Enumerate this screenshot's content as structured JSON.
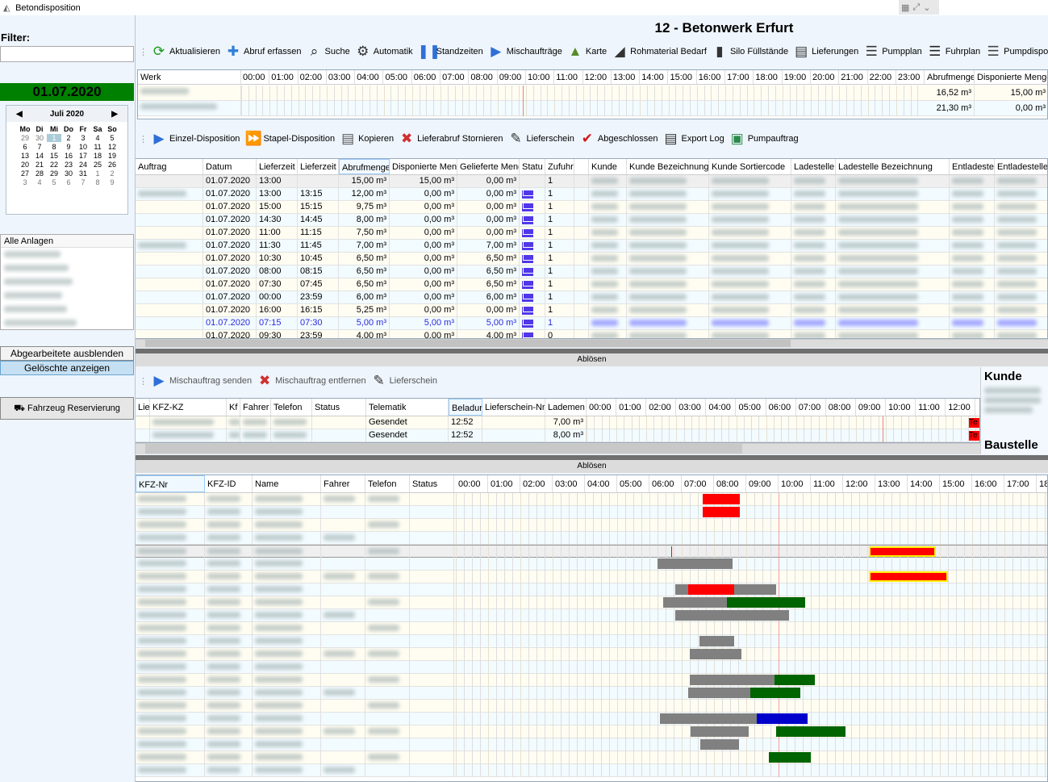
{
  "window": {
    "title": "Betondisposition"
  },
  "header": {
    "plant_title": "12 - Betonwerk Erfurt"
  },
  "left": {
    "filter_label": "Filter:",
    "filter_value": "",
    "date": "01.07.2020",
    "calendar": {
      "month": "Juli 2020",
      "days": [
        "Mo",
        "Di",
        "Mi",
        "Do",
        "Fr",
        "Sa",
        "So"
      ],
      "weeks": [
        [
          "29",
          "30",
          "1",
          "2",
          "3",
          "4",
          "5"
        ],
        [
          "6",
          "7",
          "8",
          "9",
          "10",
          "11",
          "12"
        ],
        [
          "13",
          "14",
          "15",
          "16",
          "17",
          "18",
          "19"
        ],
        [
          "20",
          "21",
          "22",
          "23",
          "24",
          "25",
          "26"
        ],
        [
          "27",
          "28",
          "29",
          "30",
          "31",
          "1",
          "2"
        ],
        [
          "3",
          "4",
          "5",
          "6",
          "7",
          "8",
          "9"
        ]
      ],
      "selected": "1"
    },
    "anlagen_header": "Alle Anlagen",
    "btn_hide": "Abgearbeitete ausblenden",
    "btn_deleted": "Gelöschte anzeigen",
    "btn_vehicle": "Fahrzeug Reservierung"
  },
  "toolbar1": [
    {
      "label": "Aktualisieren",
      "icon": "refresh-icon"
    },
    {
      "label": "Abruf erfassen",
      "icon": "plus-icon"
    },
    {
      "label": "Suche",
      "icon": "search-icon"
    },
    {
      "label": "Automatik",
      "icon": "automatic-icon"
    },
    {
      "label": "Standzeiten",
      "icon": "pause-icon"
    },
    {
      "label": "Mischaufträge",
      "icon": "play-icon"
    },
    {
      "label": "Karte",
      "icon": "map-icon"
    },
    {
      "label": "Rohmaterial Bedarf",
      "icon": "material-icon"
    },
    {
      "label": "Silo Füllstände",
      "icon": "silo-icon"
    },
    {
      "label": "Lieferungen",
      "icon": "clipboard-icon"
    },
    {
      "label": "Pumpplan",
      "icon": "pump-plan-icon"
    },
    {
      "label": "Fuhrplan",
      "icon": "truck-plan-icon"
    },
    {
      "label": "Pumpdispo",
      "icon": "pump-dispo-icon"
    },
    {
      "label": "",
      "icon": "pump-order-icon"
    }
  ],
  "werk": {
    "headers": {
      "werk": "Werk",
      "abruf": "Abrufmenge",
      "dispo": "Disponierte Menge"
    },
    "hours": [
      "00:00",
      "01:00",
      "02:00",
      "03:00",
      "04:00",
      "05:00",
      "06:00",
      "07:00",
      "08:00",
      "09:00",
      "10:00",
      "11:00",
      "12:00",
      "13:00",
      "14:00",
      "15:00",
      "16:00",
      "17:00",
      "18:00",
      "19:00",
      "20:00",
      "21:00",
      "22:00",
      "23:00"
    ],
    "rows": [
      {
        "abruf": "16,52 m³",
        "dispo": "15,00 m³"
      },
      {
        "abruf": "21,30 m³",
        "dispo": "0,00 m³"
      }
    ]
  },
  "toolbar2": [
    {
      "label": "Einzel-Disposition",
      "icon": "play-icon"
    },
    {
      "label": "Stapel-Disposition",
      "icon": "fast-forward-icon"
    },
    {
      "label": "Kopieren",
      "icon": "copy-icon"
    },
    {
      "label": "Lieferabruf Stornieren",
      "icon": "cancel-icon"
    },
    {
      "label": "Lieferschein",
      "icon": "delivery-note-icon"
    },
    {
      "label": "Abgeschlossen",
      "icon": "checkmark-icon"
    },
    {
      "label": "Export Log",
      "icon": "export-log-icon"
    },
    {
      "label": "Pumpauftrag",
      "icon": "pump-order-icon"
    }
  ],
  "orders": {
    "columns": [
      "Auftrag",
      "Datum",
      "Lieferzeit",
      "Lieferzeit",
      "Abrufmenge",
      "Disponierte Men",
      "Gelieferte Meng",
      "Statu",
      "Zufuhr",
      "",
      "Kunde",
      "Kunde Bezeichnung",
      "Kunde Sortiercode",
      "Ladestelle",
      "Ladestelle Bezeichnung",
      "Entladeste",
      "Entladestelle B"
    ],
    "rows": [
      {
        "datum": "01.07.2020",
        "lz1": "13:00",
        "lz2": "",
        "abruf": "15,00 m³",
        "dispo": "15,00 m³",
        "gel": "0,00 m³",
        "mail": false,
        "zufuhr": "1",
        "auftrag": false
      },
      {
        "datum": "01.07.2020",
        "lz1": "13:00",
        "lz2": "13:15",
        "abruf": "12,00 m³",
        "dispo": "0,00 m³",
        "gel": "0,00 m³",
        "mail": true,
        "zufuhr": "1",
        "auftrag": true
      },
      {
        "datum": "01.07.2020",
        "lz1": "15:00",
        "lz2": "15:15",
        "abruf": "9,75 m³",
        "dispo": "0,00 m³",
        "gel": "0,00 m³",
        "mail": true,
        "zufuhr": "1",
        "auftrag": false
      },
      {
        "datum": "01.07.2020",
        "lz1": "14:30",
        "lz2": "14:45",
        "abruf": "8,00 m³",
        "dispo": "0,00 m³",
        "gel": "0,00 m³",
        "mail": true,
        "zufuhr": "1",
        "auftrag": false
      },
      {
        "datum": "01.07.2020",
        "lz1": "11:00",
        "lz2": "11:15",
        "abruf": "7,50 m³",
        "dispo": "0,00 m³",
        "gel": "0,00 m³",
        "mail": true,
        "zufuhr": "1",
        "auftrag": false
      },
      {
        "datum": "01.07.2020",
        "lz1": "11:30",
        "lz2": "11:45",
        "abruf": "7,00 m³",
        "dispo": "0,00 m³",
        "gel": "7,00 m³",
        "mail": true,
        "zufuhr": "1",
        "auftrag": true
      },
      {
        "datum": "01.07.2020",
        "lz1": "10:30",
        "lz2": "10:45",
        "abruf": "6,50 m³",
        "dispo": "0,00 m³",
        "gel": "6,50 m³",
        "mail": true,
        "zufuhr": "1",
        "auftrag": false
      },
      {
        "datum": "01.07.2020",
        "lz1": "08:00",
        "lz2": "08:15",
        "abruf": "6,50 m³",
        "dispo": "0,00 m³",
        "gel": "6,50 m³",
        "mail": true,
        "zufuhr": "1",
        "auftrag": false
      },
      {
        "datum": "01.07.2020",
        "lz1": "07:30",
        "lz2": "07:45",
        "abruf": "6,50 m³",
        "dispo": "0,00 m³",
        "gel": "6,50 m³",
        "mail": true,
        "zufuhr": "1",
        "auftrag": false
      },
      {
        "datum": "01.07.2020",
        "lz1": "00:00",
        "lz2": "23:59",
        "abruf": "6,00 m³",
        "dispo": "0,00 m³",
        "gel": "6,00 m³",
        "mail": true,
        "zufuhr": "1",
        "auftrag": false
      },
      {
        "datum": "01.07.2020",
        "lz1": "16:00",
        "lz2": "16:15",
        "abruf": "5,25 m³",
        "dispo": "0,00 m³",
        "gel": "0,00 m³",
        "mail": true,
        "zufuhr": "1",
        "auftrag": false
      },
      {
        "datum": "01.07.2020",
        "lz1": "07:15",
        "lz2": "07:30",
        "abruf": "5,00 m³",
        "dispo": "5,00 m³",
        "gel": "5,00 m³",
        "mail": true,
        "zufuhr": "1",
        "auftrag": false,
        "highlight": true
      },
      {
        "datum": "01.07.2020",
        "lz1": "09:30",
        "lz2": "23:59",
        "abruf": "4,00 m³",
        "dispo": "0,00 m³",
        "gel": "4,00 m³",
        "mail": true,
        "zufuhr": "0",
        "auftrag": false
      }
    ]
  },
  "split_label": "Ablösen",
  "toolbar3": [
    {
      "label": "Mischauftrag senden",
      "icon": "play-icon"
    },
    {
      "label": "Mischauftrag entfernen",
      "icon": "cancel-icon"
    },
    {
      "label": "Lieferschein",
      "icon": "delivery-note-icon"
    }
  ],
  "trucks": {
    "columns": [
      "Lie",
      "KFZ-KZ",
      "Kf",
      "Fahrer",
      "Telefon",
      "Status",
      "Telematik",
      "Beladur",
      "Lieferschein-Nr",
      "Lademen"
    ],
    "hours": [
      "00:00",
      "01:00",
      "02:00",
      "03:00",
      "04:00",
      "05:00",
      "06:00",
      "07:00",
      "08:00",
      "09:00",
      "10:00",
      "11:00",
      "12:00"
    ],
    "rows": [
      {
        "telematik": "Gesendet",
        "beladung": "12:52",
        "menge": "7,00 m³",
        "flag": "Te"
      },
      {
        "telematik": "Gesendet",
        "beladung": "12:52",
        "menge": "8,00 m³",
        "flag": "Te"
      }
    ]
  },
  "info": {
    "kunde": "Kunde",
    "baustelle": "Baustelle"
  },
  "vehicles": {
    "columns": [
      "KFZ-Nr",
      "KFZ-ID",
      "Name",
      "Fahrer",
      "Telefon",
      "Status"
    ],
    "hours": [
      "00:00",
      "01:00",
      "02:00",
      "03:00",
      "04:00",
      "05:00",
      "06:00",
      "07:00",
      "08:00",
      "09:00",
      "10:00",
      "11:00",
      "12:00",
      "13:00",
      "14:00",
      "15:00",
      "16:00",
      "17:00",
      "18"
    ],
    "colors": {
      "red": "#ff0000",
      "gray": "#808080",
      "green": "#006400",
      "blue": "#0000cc",
      "border": "#ffee00"
    },
    "now": "10:00",
    "rows": [
      {
        "bars": [
          {
            "s": "07:39",
            "e": "08:48",
            "c": "red"
          }
        ]
      },
      {
        "bars": [
          {
            "s": "07:39",
            "e": "08:48",
            "c": "red"
          }
        ]
      },
      {
        "bars": []
      },
      {
        "bars": []
      },
      {
        "selected": true,
        "marker": "06:40",
        "bars": [
          {
            "s": "12:48",
            "e": "14:52",
            "c": "red",
            "hl": true
          }
        ]
      },
      {
        "bars": [
          {
            "s": "06:15",
            "e": "08:35",
            "c": "gray"
          }
        ]
      },
      {
        "bars": [
          {
            "s": "12:48",
            "e": "15:15",
            "c": "red",
            "hl": true
          }
        ]
      },
      {
        "bars": [
          {
            "s": "06:48",
            "e": "09:55",
            "c": "gray"
          },
          {
            "s": "07:12",
            "e": "08:37",
            "c": "red"
          }
        ]
      },
      {
        "bars": [
          {
            "s": "06:25",
            "e": "08:24",
            "c": "gray"
          },
          {
            "s": "08:24",
            "e": "10:50",
            "c": "green"
          }
        ]
      },
      {
        "bars": [
          {
            "s": "06:48",
            "e": "10:20",
            "c": "gray"
          }
        ]
      },
      {
        "bars": []
      },
      {
        "bars": [
          {
            "s": "07:33",
            "e": "08:38",
            "c": "gray"
          }
        ]
      },
      {
        "bars": [
          {
            "s": "07:15",
            "e": "08:51",
            "c": "gray"
          }
        ]
      },
      {
        "bars": []
      },
      {
        "bars": [
          {
            "s": "07:15",
            "e": "09:53",
            "c": "gray"
          },
          {
            "s": "09:53",
            "e": "11:08",
            "c": "green"
          }
        ]
      },
      {
        "bars": [
          {
            "s": "07:12",
            "e": "09:08",
            "c": "gray"
          },
          {
            "s": "09:08",
            "e": "10:41",
            "c": "green"
          }
        ]
      },
      {
        "bars": []
      },
      {
        "bars": [
          {
            "s": "06:20",
            "e": "09:20",
            "c": "gray"
          },
          {
            "s": "09:20",
            "e": "10:54",
            "c": "blue"
          }
        ]
      },
      {
        "bars": [
          {
            "s": "07:16",
            "e": "09:04",
            "c": "gray"
          },
          {
            "s": "09:56",
            "e": "12:04",
            "c": "green"
          }
        ]
      },
      {
        "bars": [
          {
            "s": "07:35",
            "e": "08:46",
            "c": "gray"
          }
        ]
      },
      {
        "bars": [
          {
            "s": "09:42",
            "e": "11:00",
            "c": "green"
          }
        ]
      },
      {
        "bars": []
      }
    ]
  }
}
